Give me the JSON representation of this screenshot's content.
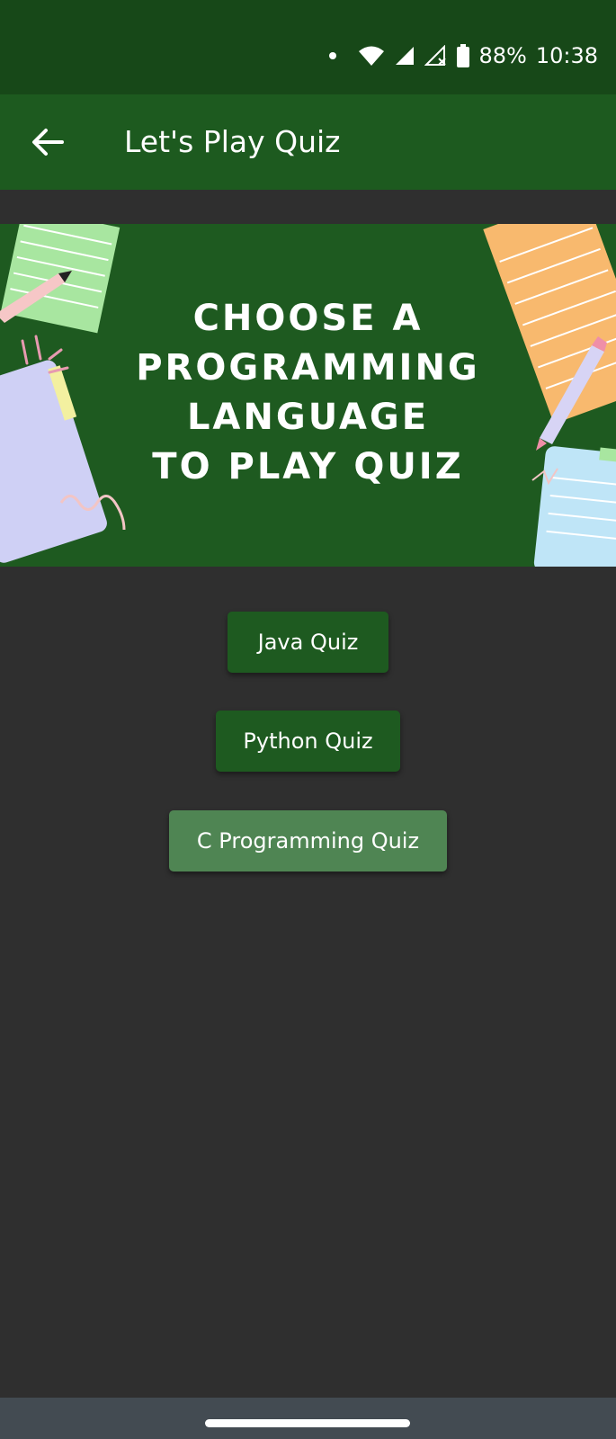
{
  "status_bar": {
    "battery": "88%",
    "time": "10:38"
  },
  "app_bar": {
    "title": "Let's Play Quiz",
    "back_icon": "arrow-left-icon"
  },
  "banner": {
    "line1": "Choose a",
    "line2": "Programming",
    "line3": "Language",
    "line4": "to play quiz"
  },
  "buttons": [
    {
      "label": "Java Quiz",
      "color": "#1e5a20"
    },
    {
      "label": "Python Quiz",
      "color": "#1e5a20"
    },
    {
      "label": "C Programming Quiz",
      "color": "#4f8553"
    }
  ],
  "colors": {
    "status_bar": "#174818",
    "app_bar": "#1d5a1f",
    "background": "#2f2f2f",
    "nav_bar": "#434b52"
  }
}
